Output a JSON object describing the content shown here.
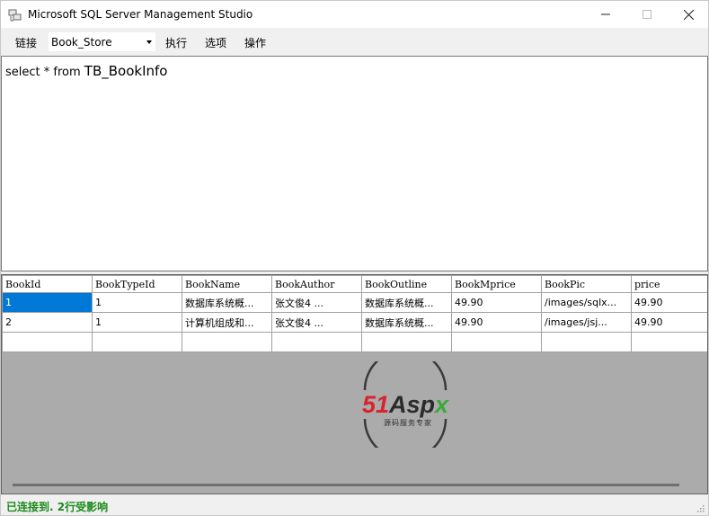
{
  "window": {
    "title": "Microsoft SQL Server Management Studio",
    "min_glyph": "—",
    "max_glyph": "☐",
    "close_glyph": "✕"
  },
  "menu": {
    "connect": "链接",
    "database": "Book_Store",
    "execute": "执行",
    "options": "选项",
    "operate": "操作"
  },
  "query": {
    "part1": "select * from ",
    "part2": "TB_BookInfo"
  },
  "grid": {
    "columns": [
      "BookId",
      "BookTypeId",
      "BookName",
      "BookAuthor",
      "BookOutline",
      "BookMprice",
      "BookPic",
      "price"
    ],
    "rows": [
      [
        "1",
        "1",
        "数据库系统概...",
        "张文俊4        ...",
        "数据库系统概...",
        "49.90",
        "/images/sqlx...",
        "49.90"
      ],
      [
        "2",
        "1",
        "计算机组成和...",
        "张文俊4        ...",
        "数据库系统概...",
        "49.90",
        "/images/jsj...",
        "49.90"
      ],
      [
        "",
        "",
        "",
        "",
        "",
        "",
        "",
        ""
      ]
    ]
  },
  "watermark": {
    "brand": "51Aspx",
    "tagline": "源码服务专家"
  },
  "status": {
    "text": "已连接到. 2行受影响"
  },
  "colors": {
    "selection": "#0078d7",
    "status_text": "#1a8a1a",
    "watermark_red": "#d9232d",
    "watermark_green": "#3aa935"
  }
}
